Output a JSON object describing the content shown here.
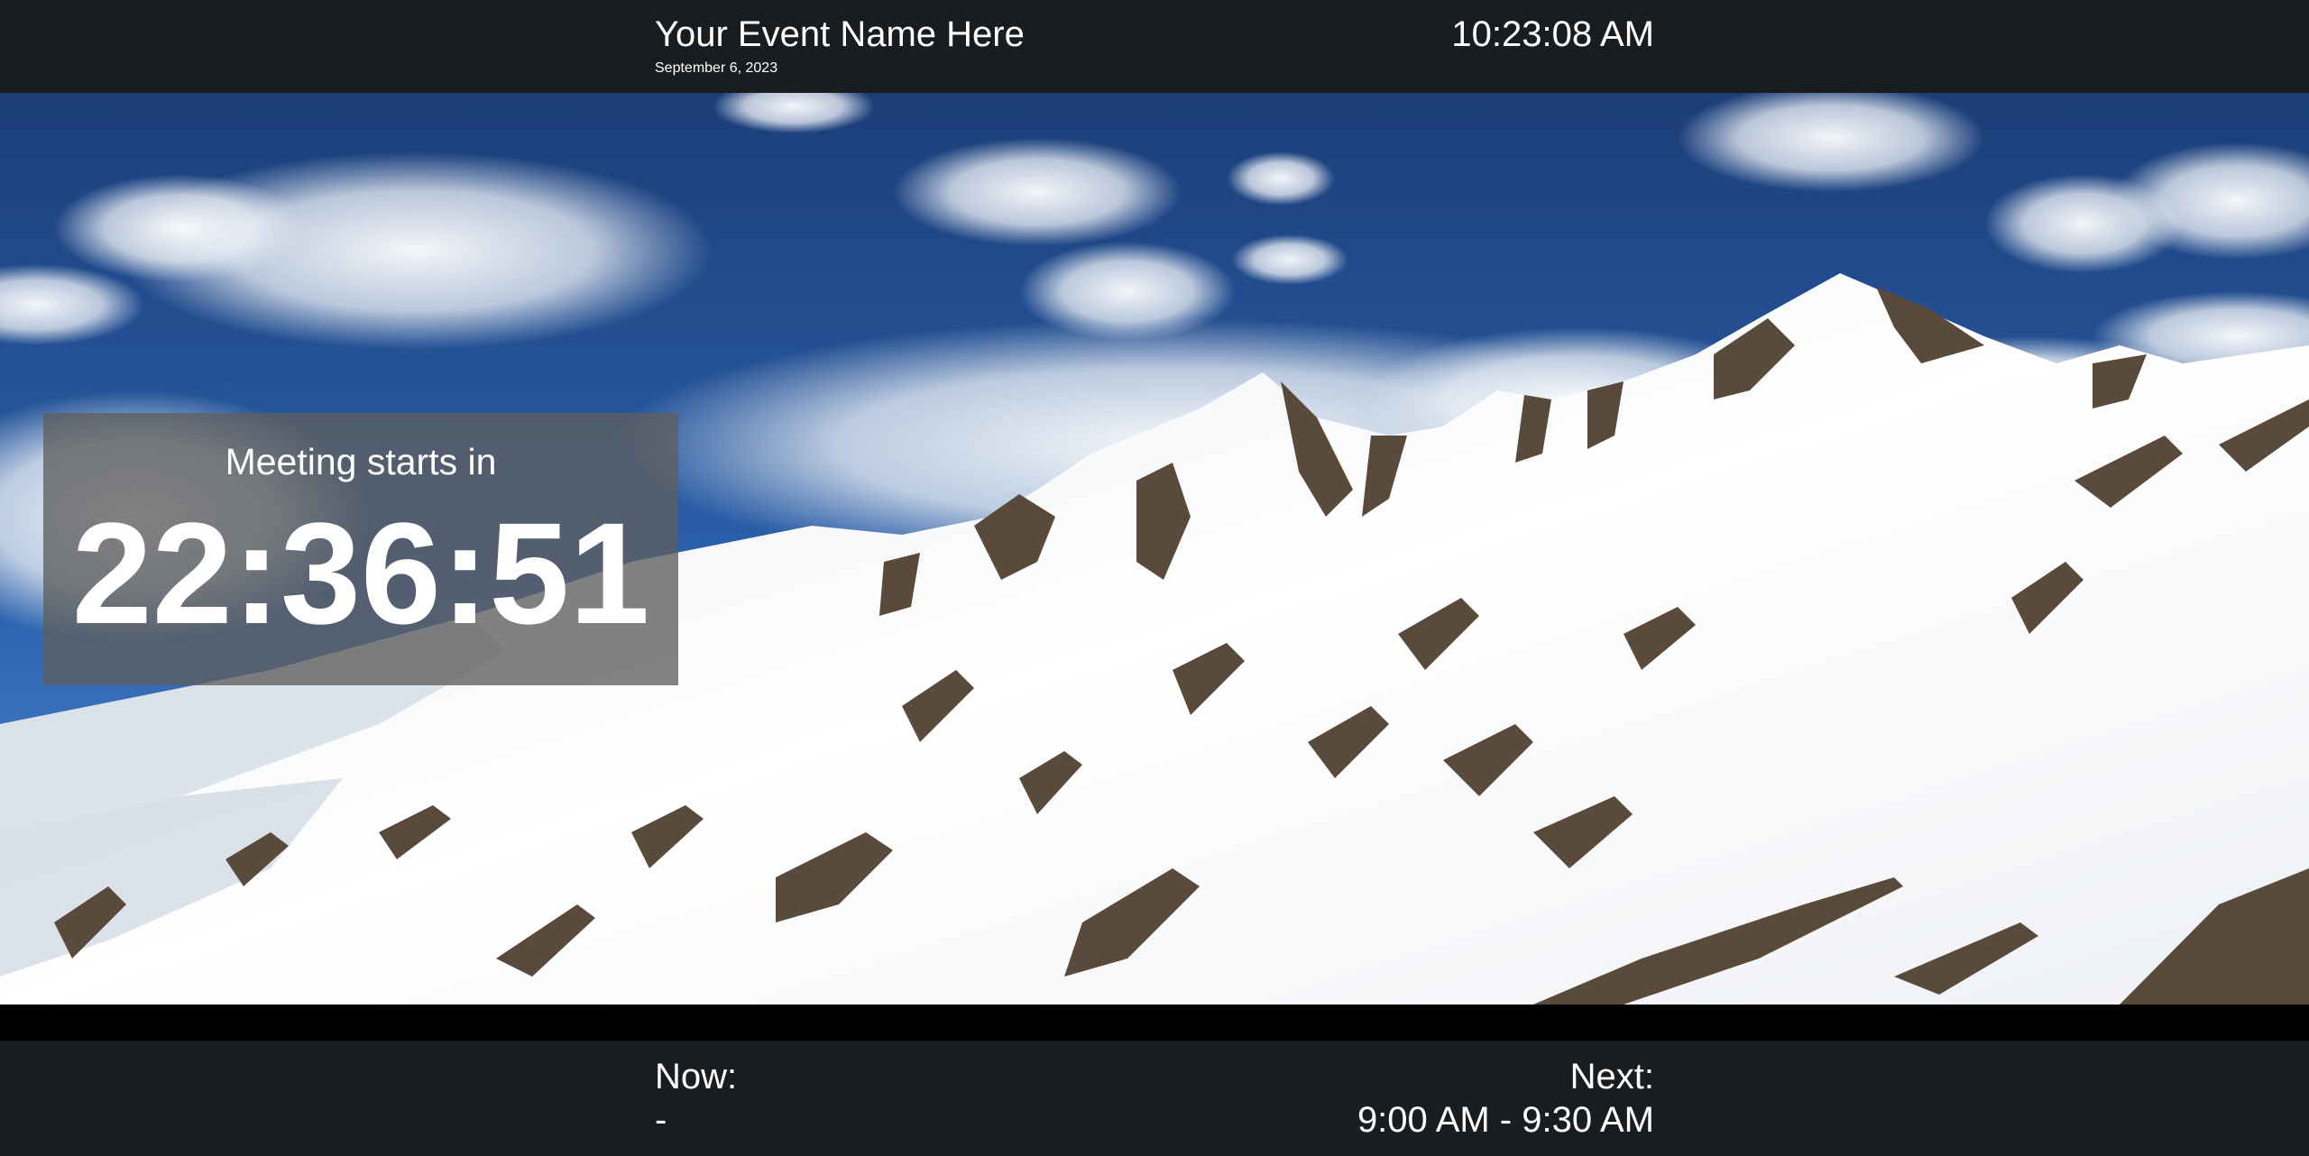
{
  "header": {
    "event_name": "Your Event Name Here",
    "date": "September 6, 2023",
    "clock": "10:23:08 AM"
  },
  "background": {
    "image": "mountain-landscape",
    "colors": {
      "sky_top": "#1c3e78",
      "sky_bottom": "#2b62ae",
      "snow": "#f4f6f8",
      "rock": "#5a4a3c",
      "bar": "#1a1d20"
    }
  },
  "countdown": {
    "label": "Meeting starts in",
    "value": "22:36:51"
  },
  "footer": {
    "now_label": "Now:",
    "now_value": "-",
    "next_label": "Next:",
    "next_value": "9:00 AM - 9:30 AM"
  }
}
